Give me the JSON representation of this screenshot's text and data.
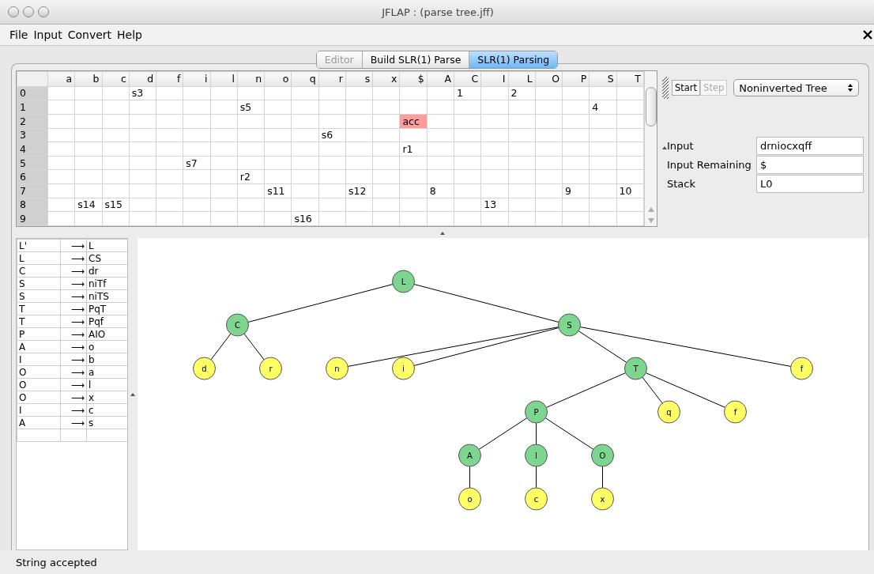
{
  "window": {
    "title": "JFLAP : (parse tree.jff)"
  },
  "menu": [
    "File",
    "Input",
    "Convert",
    "Help"
  ],
  "tabs": [
    {
      "label": "Editor",
      "selected": false,
      "disabled": true
    },
    {
      "label": "Build SLR(1) Parse",
      "selected": false,
      "disabled": false
    },
    {
      "label": "SLR(1) Parsing",
      "selected": true,
      "disabled": false
    }
  ],
  "parse_table": {
    "columns": [
      "a",
      "b",
      "c",
      "d",
      "f",
      "i",
      "l",
      "n",
      "o",
      "q",
      "r",
      "s",
      "x",
      "$",
      "A",
      "C",
      "I",
      "L",
      "O",
      "P",
      "S",
      "T"
    ],
    "rows": [
      {
        "state": "0",
        "cells": [
          null,
          null,
          null,
          {
            "text": "s3",
            "highlighted": false
          },
          null,
          null,
          null,
          null,
          null,
          null,
          null,
          null,
          null,
          null,
          null,
          {
            "text": "1",
            "highlighted": false
          },
          null,
          {
            "text": "2",
            "highlighted": false
          },
          null,
          null,
          null,
          null
        ]
      },
      {
        "state": "1",
        "cells": [
          null,
          null,
          null,
          null,
          null,
          null,
          null,
          {
            "text": "s5",
            "highlighted": false
          },
          null,
          null,
          null,
          null,
          null,
          null,
          null,
          null,
          null,
          null,
          null,
          null,
          {
            "text": "4",
            "highlighted": false
          },
          null
        ]
      },
      {
        "state": "2",
        "cells": [
          null,
          null,
          null,
          null,
          null,
          null,
          null,
          null,
          null,
          null,
          null,
          null,
          null,
          {
            "text": "acc",
            "highlighted": true
          },
          null,
          null,
          null,
          null,
          null,
          null,
          null,
          null
        ]
      },
      {
        "state": "3",
        "cells": [
          null,
          null,
          null,
          null,
          null,
          null,
          null,
          null,
          null,
          null,
          {
            "text": "s6",
            "highlighted": false
          },
          null,
          null,
          null,
          null,
          null,
          null,
          null,
          null,
          null,
          null,
          null
        ]
      },
      {
        "state": "4",
        "cells": [
          null,
          null,
          null,
          null,
          null,
          null,
          null,
          null,
          null,
          null,
          null,
          null,
          null,
          {
            "text": "r1",
            "highlighted": false
          },
          null,
          null,
          null,
          null,
          null,
          null,
          null,
          null
        ]
      },
      {
        "state": "5",
        "cells": [
          null,
          null,
          null,
          null,
          null,
          {
            "text": "s7",
            "highlighted": false
          },
          null,
          null,
          null,
          null,
          null,
          null,
          null,
          null,
          null,
          null,
          null,
          null,
          null,
          null,
          null,
          null
        ]
      },
      {
        "state": "6",
        "cells": [
          null,
          null,
          null,
          null,
          null,
          null,
          null,
          {
            "text": "r2",
            "highlighted": false
          },
          null,
          null,
          null,
          null,
          null,
          null,
          null,
          null,
          null,
          null,
          null,
          null,
          null,
          null
        ]
      },
      {
        "state": "7",
        "cells": [
          null,
          null,
          null,
          null,
          null,
          null,
          null,
          null,
          {
            "text": "s11",
            "highlighted": false
          },
          null,
          null,
          {
            "text": "s12",
            "highlighted": false
          },
          null,
          null,
          {
            "text": "8",
            "highlighted": false
          },
          null,
          null,
          null,
          null,
          {
            "text": "9",
            "highlighted": false
          },
          null,
          {
            "text": "10",
            "highlighted": false
          }
        ]
      },
      {
        "state": "8",
        "cells": [
          null,
          {
            "text": "s14",
            "highlighted": false
          },
          {
            "text": "s15",
            "highlighted": false
          },
          null,
          null,
          null,
          null,
          null,
          null,
          null,
          null,
          null,
          null,
          null,
          null,
          null,
          {
            "text": "13",
            "highlighted": false
          },
          null,
          null,
          null,
          null,
          null
        ]
      },
      {
        "state": "9",
        "cells": [
          null,
          null,
          null,
          null,
          null,
          null,
          null,
          null,
          null,
          {
            "text": "s16",
            "highlighted": false
          },
          null,
          null,
          null,
          null,
          null,
          null,
          null,
          null,
          null,
          null,
          null,
          null
        ]
      }
    ]
  },
  "toolbar": {
    "buttons": [
      {
        "label": "Start",
        "disabled": false
      },
      {
        "label": "Step",
        "disabled": true
      }
    ],
    "view_select": "Noninverted Tree"
  },
  "fields": [
    {
      "label": "Input",
      "value": "drniocxqff"
    },
    {
      "label": "Input Remaining",
      "value": "$"
    },
    {
      "label": "Stack",
      "value": "L0"
    }
  ],
  "grammar": [
    {
      "lhs": "L'",
      "arrow": "⟶",
      "rhs": "L"
    },
    {
      "lhs": "L",
      "arrow": "⟶",
      "rhs": "CS"
    },
    {
      "lhs": "C",
      "arrow": "⟶",
      "rhs": "dr"
    },
    {
      "lhs": "S",
      "arrow": "⟶",
      "rhs": "niTf"
    },
    {
      "lhs": "S",
      "arrow": "⟶",
      "rhs": "niTS"
    },
    {
      "lhs": "T",
      "arrow": "⟶",
      "rhs": "PqT"
    },
    {
      "lhs": "T",
      "arrow": "⟶",
      "rhs": "Pqf"
    },
    {
      "lhs": "P",
      "arrow": "⟶",
      "rhs": "AIO"
    },
    {
      "lhs": "A",
      "arrow": "⟶",
      "rhs": "o"
    },
    {
      "lhs": "I",
      "arrow": "⟶",
      "rhs": "b"
    },
    {
      "lhs": "O",
      "arrow": "⟶",
      "rhs": "a"
    },
    {
      "lhs": "O",
      "arrow": "⟶",
      "rhs": "l"
    },
    {
      "lhs": "O",
      "arrow": "⟶",
      "rhs": "x"
    },
    {
      "lhs": "I",
      "arrow": "⟶",
      "rhs": "c"
    },
    {
      "lhs": "A",
      "arrow": "⟶",
      "rhs": "s"
    }
  ],
  "parse_tree": {
    "label": "L",
    "kind": "nonterminal",
    "children": [
      {
        "label": "C",
        "kind": "nonterminal",
        "children": [
          {
            "label": "d",
            "kind": "terminal"
          },
          {
            "label": "r",
            "kind": "terminal"
          }
        ]
      },
      {
        "label": "S",
        "kind": "nonterminal",
        "children": [
          {
            "label": "n",
            "kind": "terminal"
          },
          {
            "label": "i",
            "kind": "terminal"
          },
          {
            "label": "T",
            "kind": "nonterminal",
            "children": [
              {
                "label": "P",
                "kind": "nonterminal",
                "children": [
                  {
                    "label": "A",
                    "kind": "nonterminal",
                    "children": [
                      {
                        "label": "o",
                        "kind": "terminal"
                      }
                    ]
                  },
                  {
                    "label": "I",
                    "kind": "nonterminal",
                    "children": [
                      {
                        "label": "c",
                        "kind": "terminal"
                      }
                    ]
                  },
                  {
                    "label": "O",
                    "kind": "nonterminal",
                    "children": [
                      {
                        "label": "x",
                        "kind": "terminal"
                      }
                    ]
                  }
                ]
              },
              {
                "label": "q",
                "kind": "terminal"
              },
              {
                "label": "f",
                "kind": "terminal"
              }
            ]
          },
          {
            "label": "f",
            "kind": "terminal"
          }
        ]
      }
    ]
  },
  "status_bar": "String accepted"
}
